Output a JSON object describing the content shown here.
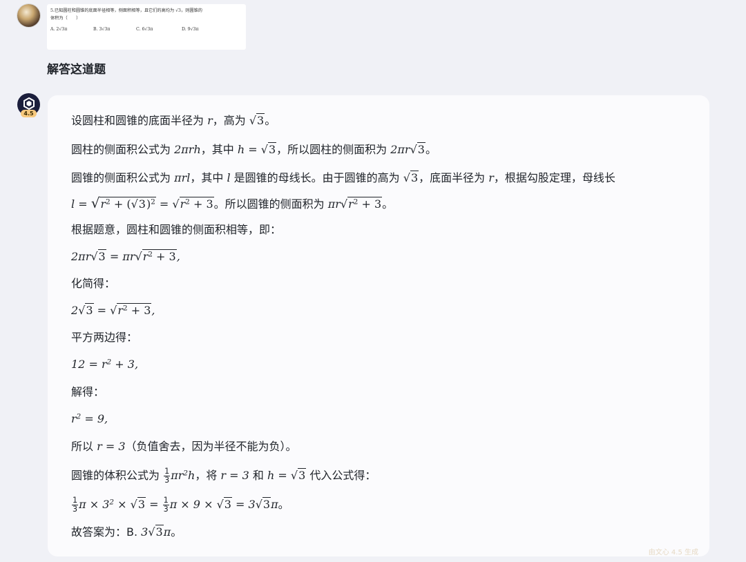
{
  "user": {
    "question_image": {
      "line1": "5.已知圆柱和圆锥的底面半径相等，侧面积相等，且它们的高均为 √3，则圆锥的",
      "line2": "体积为（　　）",
      "options": [
        "A. 2√3π",
        "B.  3√3π",
        "C. 6√3π",
        "D. 9√3π"
      ]
    },
    "prompt": "解答这道题"
  },
  "bot": {
    "badge": "4.5",
    "watermark": "由文心 4.5 生成",
    "answer": {
      "l1": [
        "设圆柱和圆锥的底面半径为 ",
        "r",
        "，高为 ",
        "3",
        "。"
      ],
      "l2": [
        "圆柱的侧面积公式为 ",
        "2πrh",
        "，其中 ",
        "h = ",
        "3",
        "，所以圆柱的侧面积为 ",
        "2πr",
        "3",
        "。"
      ],
      "l3": [
        "圆锥的侧面积公式为 ",
        "πrl",
        "，其中 ",
        "l",
        " 是圆锥的母线长。由于圆锥的高为 ",
        "3",
        "，底面半径为 ",
        "r",
        "，根据勾股定理，母线长"
      ],
      "l4": [
        "l = ",
        "r",
        "2",
        " + (",
        "3",
        ")",
        "2",
        " = ",
        "r",
        "2",
        " + 3",
        "。所以圆锥的侧面积为 ",
        "πr",
        "r",
        "2",
        " + 3",
        "。"
      ],
      "l5": "根据题意，圆柱和圆锥的侧面积相等，即：",
      "l6": [
        "2πr",
        "3",
        " = πr",
        "r",
        "2",
        " + 3",
        ","
      ],
      "l7": "化简得：",
      "l8": [
        "2",
        "3",
        " = ",
        "r",
        "2",
        " + 3",
        ","
      ],
      "l9": "平方两边得：",
      "l10": [
        "12 = ",
        "r",
        "2",
        " + 3,"
      ],
      "l11": "解得：",
      "l12": [
        "r",
        "2",
        " = 9,"
      ],
      "l13": [
        "所以 ",
        "r = 3",
        "（负值舍去，因为半径不能为负）。"
      ],
      "l14": [
        "圆锥的体积公式为 ",
        "1",
        "3",
        "πr",
        "2",
        "h",
        "，将 ",
        "r = 3",
        " 和 ",
        "h = ",
        "3",
        " 代入公式得："
      ],
      "l15": [
        "1",
        "3",
        "π × 3",
        "2",
        " × ",
        "3",
        " = ",
        "1",
        "3",
        "π × 9 × ",
        "3",
        " = 3",
        "3",
        "π",
        "。"
      ],
      "l16": [
        "故答案为：B. ",
        "3",
        "3",
        "π",
        "。"
      ]
    }
  }
}
